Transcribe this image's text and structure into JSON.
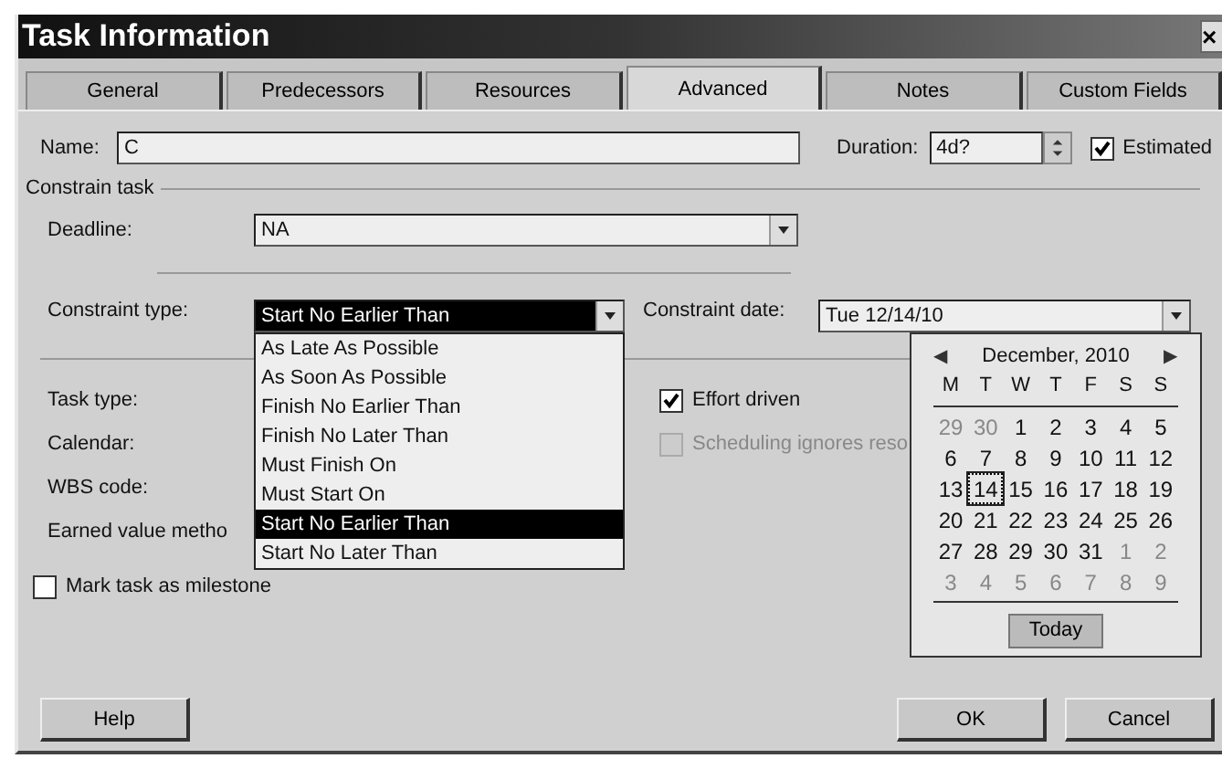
{
  "window": {
    "title": "Task Information",
    "close": "×"
  },
  "tabs": [
    {
      "label": "General",
      "selected": false
    },
    {
      "label": "Predecessors",
      "selected": false
    },
    {
      "label": "Resources",
      "selected": false
    },
    {
      "label": "Advanced",
      "selected": true
    },
    {
      "label": "Notes",
      "selected": false
    },
    {
      "label": "Custom Fields",
      "selected": false
    }
  ],
  "name": {
    "label": "Name:",
    "value": "C"
  },
  "duration": {
    "label": "Duration:",
    "value": "4d?"
  },
  "estimated": {
    "label": "Estimated",
    "checked": true
  },
  "constrain_task": {
    "title": "Constrain task",
    "deadline": {
      "label": "Deadline:",
      "value": "NA"
    },
    "constraint_type": {
      "label": "Constraint type:",
      "value": "Start No Earlier Than",
      "expanded": true,
      "options": [
        {
          "label": "As Late As Possible",
          "selected": false
        },
        {
          "label": "As Soon As Possible",
          "selected": false
        },
        {
          "label": "Finish No Earlier Than",
          "selected": false
        },
        {
          "label": "Finish No Later Than",
          "selected": false
        },
        {
          "label": "Must Finish On",
          "selected": false
        },
        {
          "label": "Must Start On",
          "selected": false
        },
        {
          "label": "Start No Earlier Than",
          "selected": true
        },
        {
          "label": "Start No Later Than",
          "selected": false
        }
      ]
    },
    "constraint_date": {
      "label": "Constraint date:",
      "value": "Tue 12/14/10",
      "expanded": true
    }
  },
  "left_labels": [
    "Task type:",
    "Calendar:",
    "WBS code:",
    "Earned value metho"
  ],
  "options": [
    {
      "label": "Effort driven",
      "checked": true,
      "disabled": false
    },
    {
      "label": "Scheduling ignores reso",
      "checked": false,
      "disabled": true
    }
  ],
  "milestone": {
    "label": "Mark task as milestone",
    "checked": false
  },
  "calendar": {
    "prev": "◀",
    "next": "▶",
    "month": "December, 2010",
    "weekdays": [
      "M",
      "T",
      "W",
      "T",
      "F",
      "S",
      "S"
    ],
    "weeks": [
      [
        {
          "d": "29",
          "muted": true,
          "selected": false
        },
        {
          "d": "30",
          "muted": true,
          "selected": false
        },
        {
          "d": "1",
          "muted": false,
          "selected": false
        },
        {
          "d": "2",
          "muted": false,
          "selected": false
        },
        {
          "d": "3",
          "muted": false,
          "selected": false
        },
        {
          "d": "4",
          "muted": false,
          "selected": false
        },
        {
          "d": "5",
          "muted": false,
          "selected": false
        }
      ],
      [
        {
          "d": "6",
          "muted": false,
          "selected": false
        },
        {
          "d": "7",
          "muted": false,
          "selected": false
        },
        {
          "d": "8",
          "muted": false,
          "selected": false
        },
        {
          "d": "9",
          "muted": false,
          "selected": false
        },
        {
          "d": "10",
          "muted": false,
          "selected": false
        },
        {
          "d": "11",
          "muted": false,
          "selected": false
        },
        {
          "d": "12",
          "muted": false,
          "selected": false
        }
      ],
      [
        {
          "d": "13",
          "muted": false,
          "selected": false
        },
        {
          "d": "14",
          "muted": false,
          "selected": true
        },
        {
          "d": "15",
          "muted": false,
          "selected": false
        },
        {
          "d": "16",
          "muted": false,
          "selected": false
        },
        {
          "d": "17",
          "muted": false,
          "selected": false
        },
        {
          "d": "18",
          "muted": false,
          "selected": false
        },
        {
          "d": "19",
          "muted": false,
          "selected": false
        }
      ],
      [
        {
          "d": "20",
          "muted": false,
          "selected": false
        },
        {
          "d": "21",
          "muted": false,
          "selected": false
        },
        {
          "d": "22",
          "muted": false,
          "selected": false
        },
        {
          "d": "23",
          "muted": false,
          "selected": false
        },
        {
          "d": "24",
          "muted": false,
          "selected": false
        },
        {
          "d": "25",
          "muted": false,
          "selected": false
        },
        {
          "d": "26",
          "muted": false,
          "selected": false
        }
      ],
      [
        {
          "d": "27",
          "muted": false,
          "selected": false
        },
        {
          "d": "28",
          "muted": false,
          "selected": false
        },
        {
          "d": "29",
          "muted": false,
          "selected": false
        },
        {
          "d": "30",
          "muted": false,
          "selected": false
        },
        {
          "d": "31",
          "muted": false,
          "selected": false
        },
        {
          "d": "1",
          "muted": true,
          "selected": false
        },
        {
          "d": "2",
          "muted": true,
          "selected": false
        }
      ],
      [
        {
          "d": "3",
          "muted": true,
          "selected": false
        },
        {
          "d": "4",
          "muted": true,
          "selected": false
        },
        {
          "d": "5",
          "muted": true,
          "selected": false
        },
        {
          "d": "6",
          "muted": true,
          "selected": false
        },
        {
          "d": "7",
          "muted": true,
          "selected": false
        },
        {
          "d": "8",
          "muted": true,
          "selected": false
        },
        {
          "d": "9",
          "muted": true,
          "selected": false
        }
      ]
    ],
    "today": "Today"
  },
  "buttons": {
    "help": "Help",
    "ok": "OK",
    "cancel": "Cancel"
  }
}
